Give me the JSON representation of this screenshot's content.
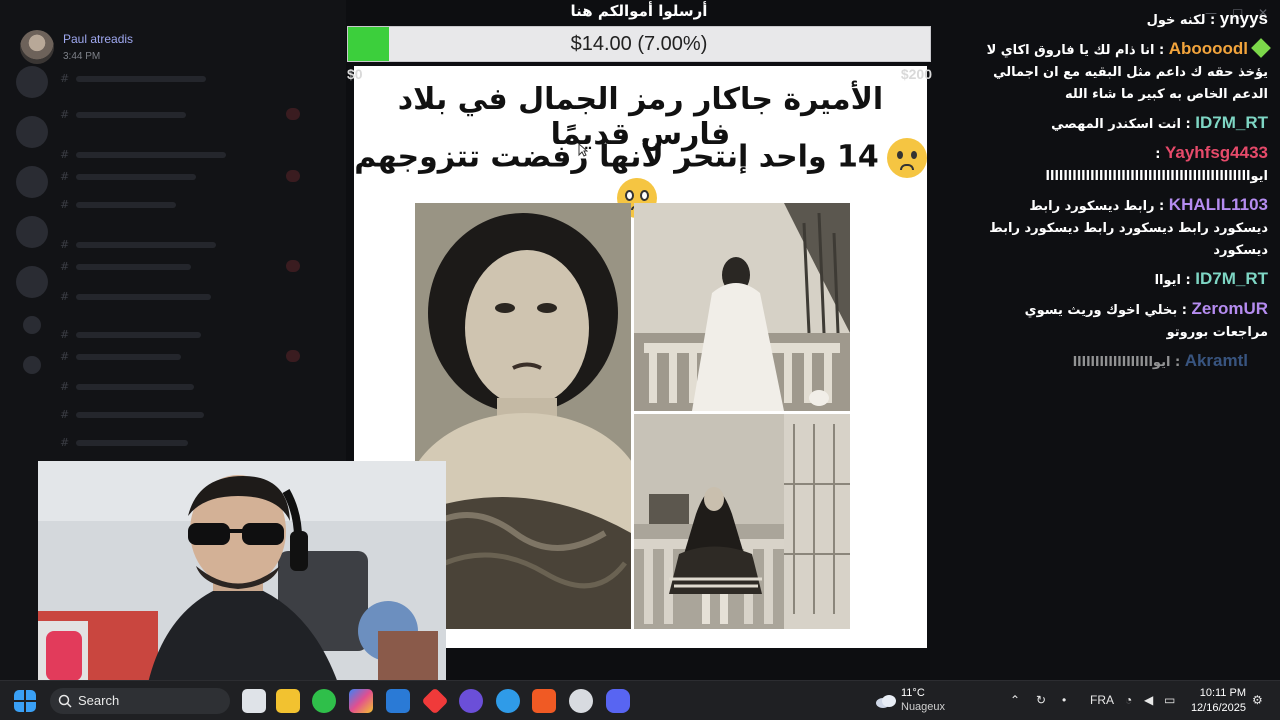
{
  "discord": {
    "username": "Paul atreadis",
    "timestamp": "3:44 PM"
  },
  "donation": {
    "title": "أرسلوا أموالكم هنا",
    "progress_text": "$14.00 (7.00%)",
    "progress_fraction": 0.07,
    "min_label": "$0",
    "max_label": "$200",
    "fill_color": "#3ccf3c"
  },
  "meme": {
    "line1": "الأميرة جاكار رمز الجمال في بلاد فارس قديمًا",
    "line2": "14 واحد إنتحر لأنها رفضت تتزوجهم"
  },
  "chat": [
    {
      "user": "ynyys",
      "color": "#ffffff",
      "text": "لكنه خول"
    },
    {
      "user": "Aboooodl",
      "color": "#f2a43c",
      "badge": "diamond",
      "text": "انا ذام لك يا فاروق اكاي لا يؤخذ حقه ك داعم مثل البقيه مع ان اجمالي الدعم الخاص به كبير ما شاء الله"
    },
    {
      "user": "ID7M_RT",
      "color": "#7ed6c4",
      "text": "انت اسكندر المهصي"
    },
    {
      "user": "Yayhfsg4433",
      "color": "#e64a6a",
      "text": "ايواااااااااااااااااااااااااااااااااااااااااااااا"
    },
    {
      "user": "KHALIL1103",
      "color": "#b58cf0",
      "text": "رابط ديسكورد رابط ديسكورد رابط ديسكورد رابط ديسكورد رابط ديسكورد"
    },
    {
      "user": "ID7M_RT",
      "color": "#7ed6c4",
      "text": "ايواا"
    },
    {
      "user": "ZeromUR",
      "color": "#b58cf0",
      "text": "بخلي اخوك وريث يسوي مراجعات بوروتو"
    },
    {
      "user": "Akramtl",
      "color": "#5b8ed9",
      "faded": true,
      "text": "ايواااااااااااااااااا"
    }
  ],
  "taskbar": {
    "search_label": "Search",
    "weather_temp": "11°C",
    "weather_cond": "Nuageux",
    "language": "FRA",
    "time": "10:11 PM",
    "date": "12/16/2025"
  }
}
